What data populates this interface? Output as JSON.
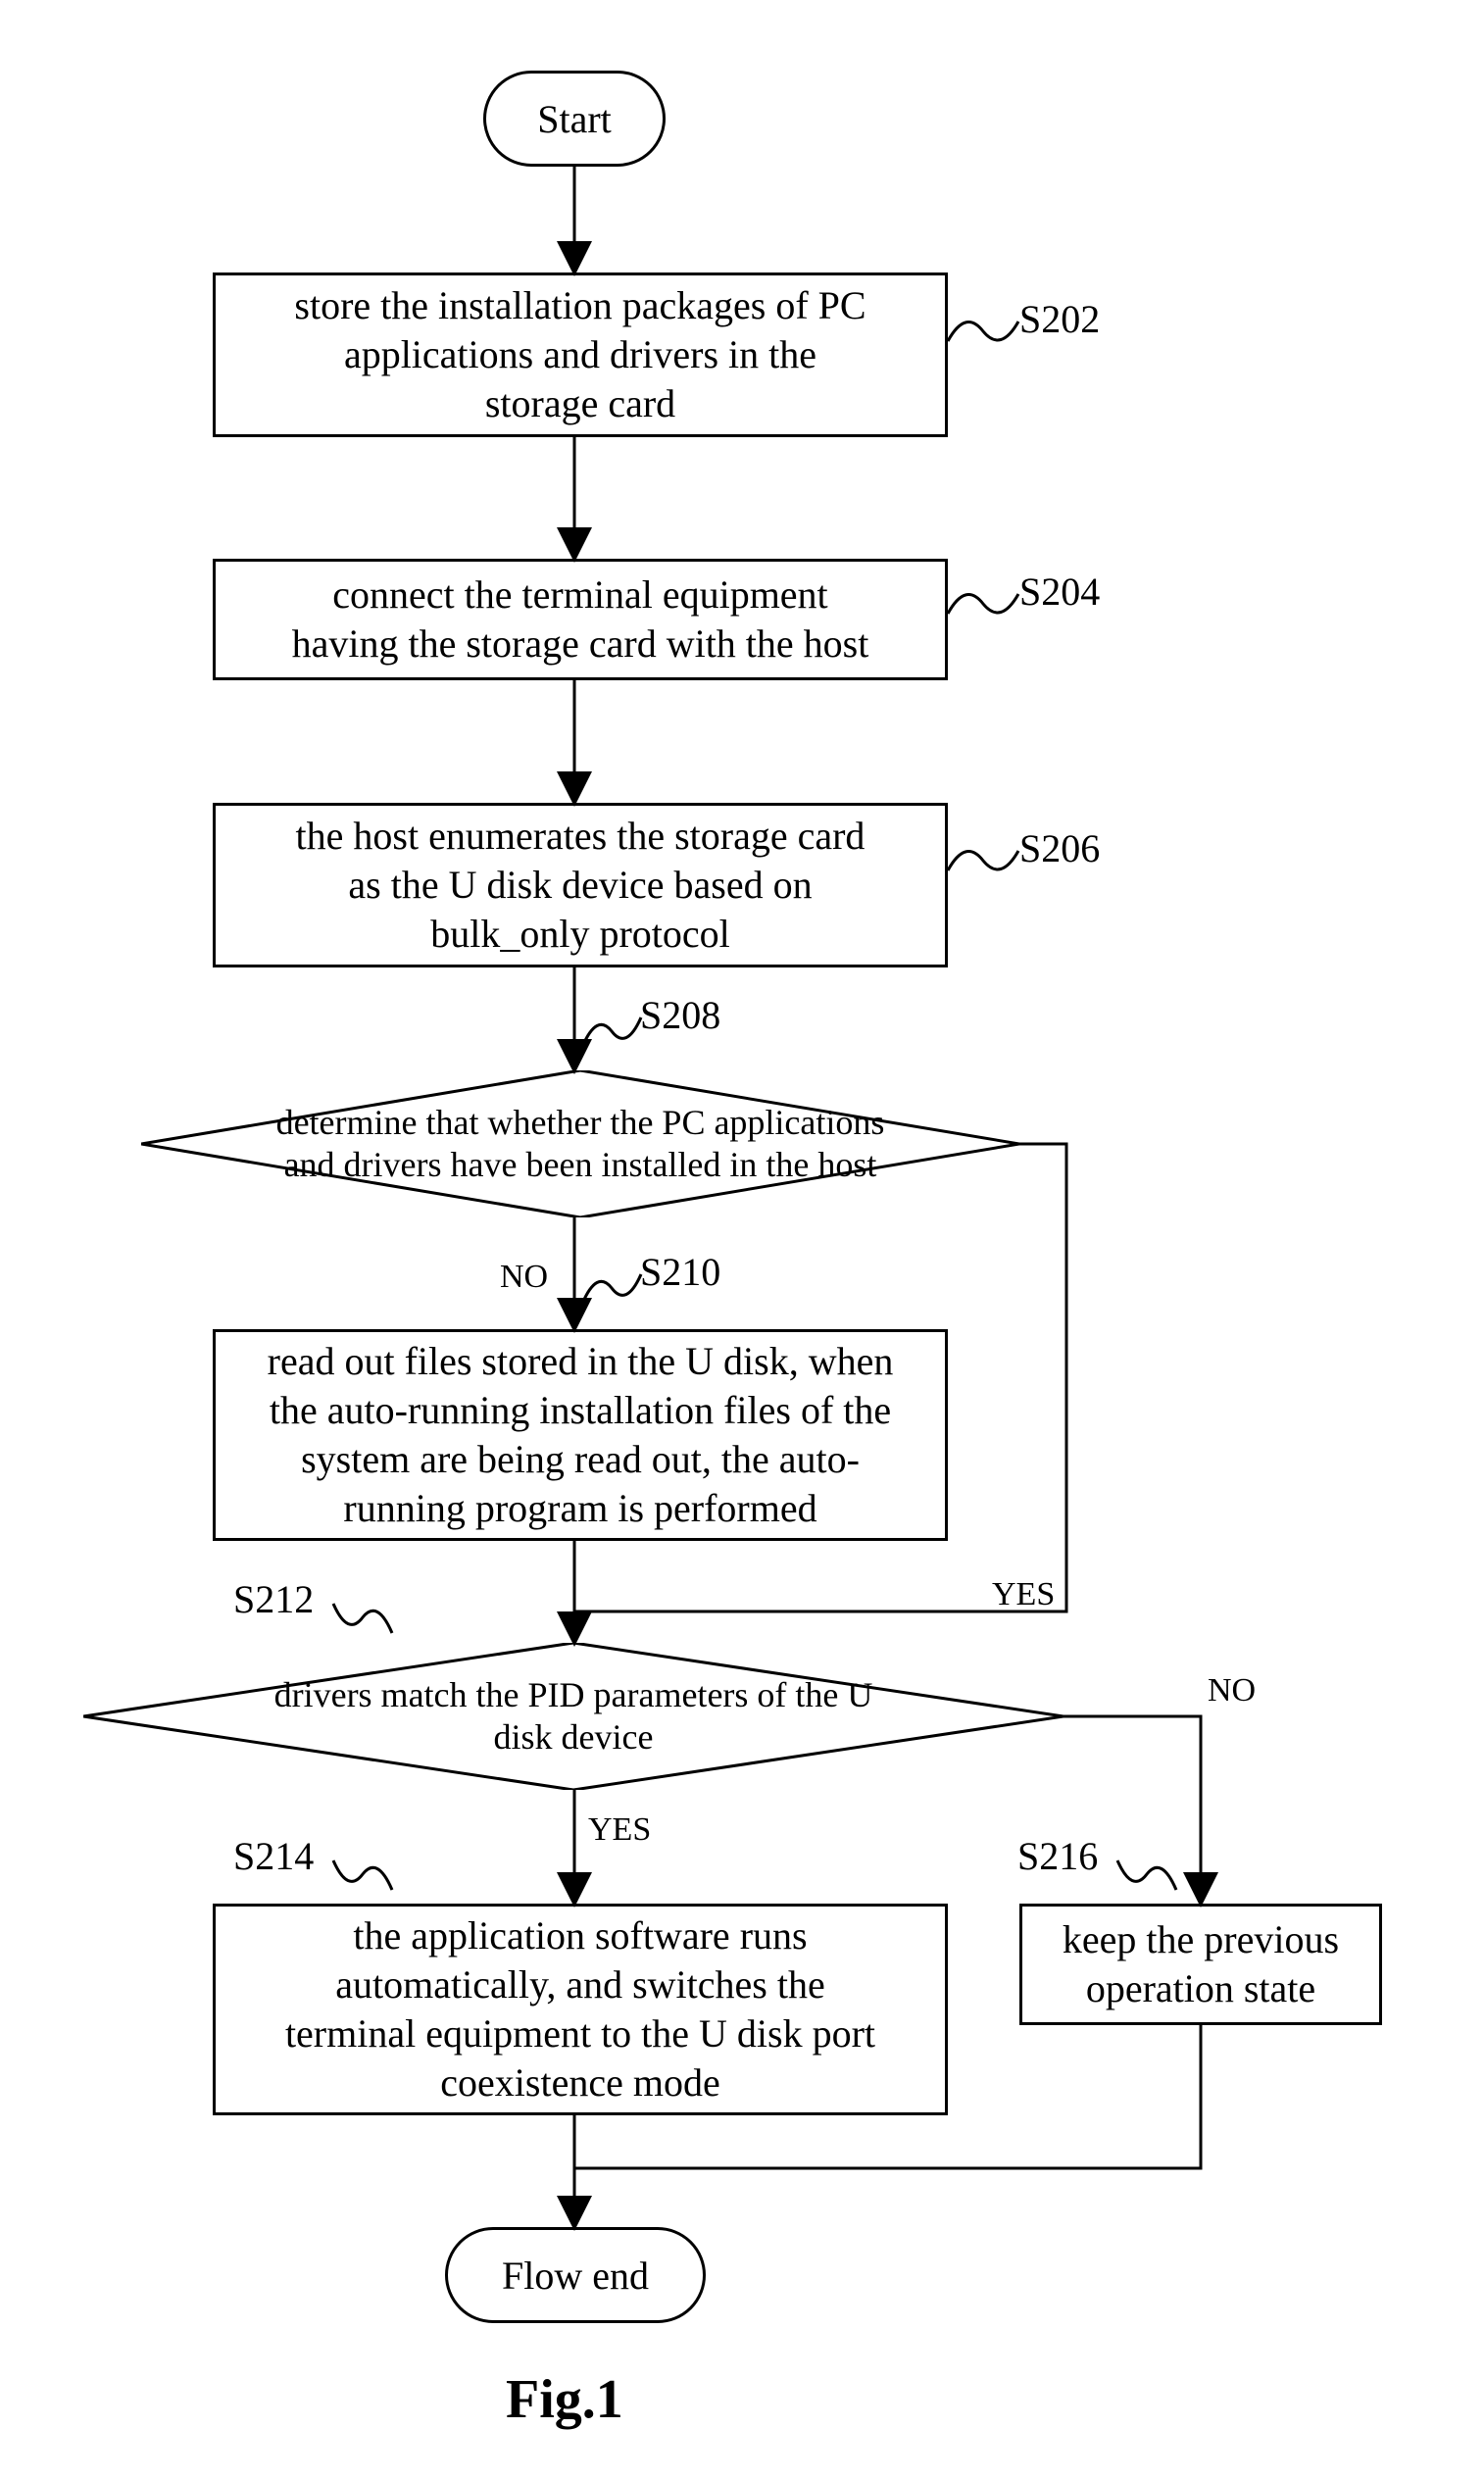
{
  "nodes": {
    "start": "Start",
    "s202": "store the installation packages of PC\napplications and drivers in the\nstorage card",
    "s204": "connect the terminal equipment\nhaving the storage card with the host",
    "s206": "the host enumerates the storage card\nas the U disk device based on\nbulk_only protocol",
    "s208": "determine that whether the PC applications\nand drivers have been installed in the host",
    "s210": "read out files stored in the U disk, when\nthe auto-running installation files of the\nsystem are being read out, the auto-\nrunning program is performed",
    "s212": "drivers match the PID parameters of the U\ndisk device",
    "s214": "the application software runs\nautomatically, and switches the\nterminal equipment to the U disk port\ncoexistence mode",
    "s216": "keep the previous\noperation state",
    "end": "Flow end"
  },
  "labels": {
    "s202": "S202",
    "s204": "S204",
    "s206": "S206",
    "s208": "S208",
    "s210": "S210",
    "s212": "S212",
    "s214": "S214",
    "s216": "S216"
  },
  "branches": {
    "no": "NO",
    "yes": "YES"
  },
  "figure": "Fig.1"
}
